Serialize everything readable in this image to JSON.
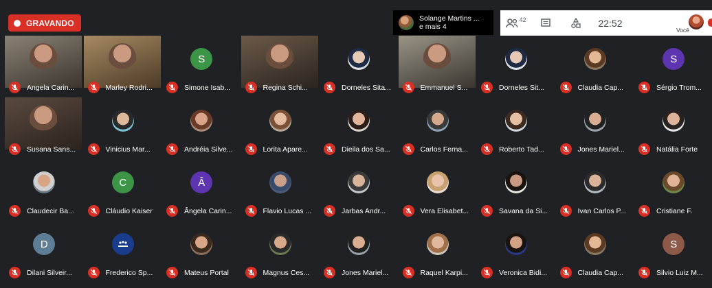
{
  "recording": {
    "label": "GRAVANDO"
  },
  "presenting": {
    "line1": "Solange Martins ...",
    "line2": "e mais 4"
  },
  "controls": {
    "people_count": "42",
    "clock": "22:52",
    "self_label": "Você"
  },
  "participants": [
    {
      "name": "Angela Carin...",
      "type": "video",
      "v1": "#8a8274",
      "v2": "#3b352e"
    },
    {
      "name": "Marley Rodri...",
      "type": "video",
      "v1": "#a58a62",
      "v2": "#4e3b27"
    },
    {
      "name": "Simone Isab...",
      "type": "initial",
      "initial": "S",
      "color": "#3c9447"
    },
    {
      "name": "Regina Schi...",
      "type": "video",
      "v1": "#6c5a48",
      "v2": "#2a2420"
    },
    {
      "name": "Dorneles Sita...",
      "type": "photo",
      "skin": "#e8c9b5",
      "hair": "#1f2b44",
      "bg": "#dfe3ea"
    },
    {
      "name": "Emmanuel S...",
      "type": "video",
      "v1": "#9a9486",
      "v2": "#3a3630"
    },
    {
      "name": "Dorneles Sit...",
      "type": "photo",
      "skin": "#e8c9b5",
      "hair": "#1f2b44",
      "bg": "#dfe3ea"
    },
    {
      "name": "Claudia Cap...",
      "type": "photo",
      "skin": "#e3b896",
      "hair": "#5a3a22",
      "bg": "#8a7862"
    },
    {
      "name": "Sérgio Trom...",
      "type": "initial",
      "initial": "S",
      "color": "#5e35b1"
    },
    {
      "name": "Susana Sans...",
      "type": "video",
      "v1": "#5a4a3e",
      "v2": "#2b231e"
    },
    {
      "name": "Vinicius Mar...",
      "type": "photo",
      "skin": "#e0b89a",
      "hair": "#2a2a2a",
      "bg": "#7cc3d8"
    },
    {
      "name": "Andréia Silve...",
      "type": "photo",
      "skin": "#d9a48a",
      "hair": "#6a3a28",
      "bg": "#a88a76"
    },
    {
      "name": "Lorita Apare...",
      "type": "photo",
      "skin": "#e4bca2",
      "hair": "#7a5038",
      "bg": "#b9a698"
    },
    {
      "name": "Dieila dos Sa...",
      "type": "photo",
      "skin": "#e2b69a",
      "hair": "#2b1e18",
      "bg": "#d9d2cc"
    },
    {
      "name": "Carlos Ferna...",
      "type": "photo",
      "skin": "#d6a88c",
      "hair": "#3a3a3a",
      "bg": "#8fa3b6"
    },
    {
      "name": "Roberto Tad...",
      "type": "photo",
      "skin": "#e6c0a2",
      "hair": "#3b2a20",
      "bg": "#cfd6dc"
    },
    {
      "name": "Jones Mariel...",
      "type": "photo",
      "skin": "#d8ad92",
      "hair": "#222222",
      "bg": "#9aa2aa"
    },
    {
      "name": "Natália Forte",
      "type": "photo",
      "skin": "#ddb39a",
      "hair": "#2a2220",
      "bg": "#e6e6e6"
    },
    {
      "name": "Claudecir Ba...",
      "type": "photo",
      "skin": "#d7a586",
      "hair": "#cfcfcf",
      "bg": "#6d7a86"
    },
    {
      "name": "Cláudio Kaiser",
      "type": "initial",
      "initial": "C",
      "color": "#3c9447"
    },
    {
      "name": "Ângela Carin...",
      "type": "initial",
      "initial": "Â",
      "color": "#5e35b1"
    },
    {
      "name": "Flavio Lucas ...",
      "type": "photo",
      "skin": "#caa08a",
      "hair": "#3a4a6a",
      "bg": "#4a5a78"
    },
    {
      "name": "Jarbas Andr...",
      "type": "photo",
      "skin": "#d9b49a",
      "hair": "#3a3a3a",
      "bg": "#c6c9cc"
    },
    {
      "name": "Vera Elisabet...",
      "type": "photo",
      "skin": "#e8c2aa",
      "hair": "#c8a070",
      "bg": "#e9dcd2"
    },
    {
      "name": "Savana da Si...",
      "type": "photo",
      "skin": "#c89a80",
      "hair": "#1a1410",
      "bg": "#e8e6e2"
    },
    {
      "name": "Ivan Carlos P...",
      "type": "photo",
      "skin": "#dab29a",
      "hair": "#2c2c2c",
      "bg": "#b4bcc4"
    },
    {
      "name": "Cristiane F.",
      "type": "photo",
      "skin": "#e0b496",
      "hair": "#6a4a2a",
      "bg": "#6e8a4a"
    },
    {
      "name": "Dilani Silveir...",
      "type": "initial",
      "initial": "D",
      "color": "#5f7d95"
    },
    {
      "name": "Frederico Sp...",
      "type": "logo",
      "color": "#1a3c8c"
    },
    {
      "name": "Mateus Portal",
      "type": "photo",
      "skin": "#d6a686",
      "hair": "#3a2a1e",
      "bg": "#8a6e5a"
    },
    {
      "name": "Magnus Ces...",
      "type": "photo",
      "skin": "#d8a88a",
      "hair": "#2a2a2a",
      "bg": "#6a7a4e"
    },
    {
      "name": "Jones Mariel...",
      "type": "photo",
      "skin": "#d8ad92",
      "hair": "#222222",
      "bg": "#9aa2aa"
    },
    {
      "name": "Raquel Karpi...",
      "type": "photo",
      "skin": "#e0b89e",
      "hair": "#a0704a",
      "bg": "#cfc6be"
    },
    {
      "name": "Veronica Bidi...",
      "type": "photo",
      "skin": "#d2a285",
      "hair": "#1a1410",
      "bg": "#2a3a8a"
    },
    {
      "name": "Claudia Cap...",
      "type": "photo",
      "skin": "#e3b896",
      "hair": "#5a3a22",
      "bg": "#8a7862"
    },
    {
      "name": "Silvio Luiz M...",
      "type": "initial",
      "initial": "S",
      "color": "#8d5a4a"
    }
  ]
}
